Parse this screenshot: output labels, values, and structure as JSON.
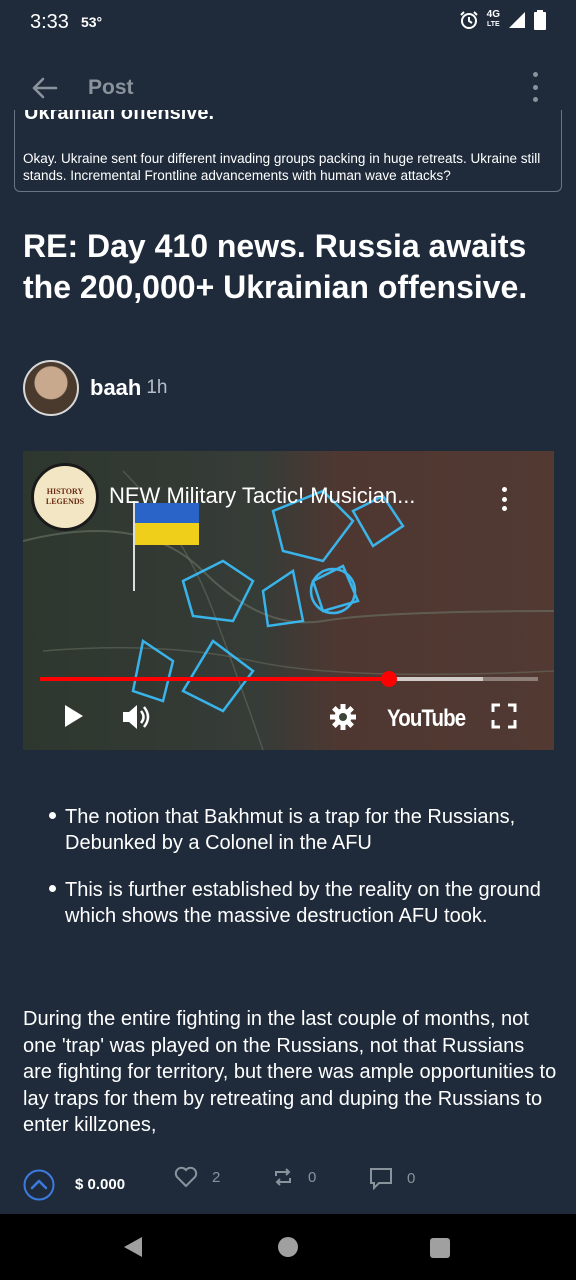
{
  "status": {
    "time": "3:33",
    "temp": "53°",
    "network": "4G",
    "network_sub": "LTE"
  },
  "appbar": {
    "title": "Post"
  },
  "quote": {
    "heading": "Ukrainian offensive.",
    "text": "Okay. Ukraine sent four different invading groups packing in huge retreats. Ukraine still stands. Incremental Frontline advancements with human wave attacks?"
  },
  "post": {
    "title": "RE: Day 410 news. Russia awaits the 200,000+ Ukrainian offensive.",
    "author": "baah",
    "time": "1h"
  },
  "video": {
    "title": "NEW Military Tactic! Musician...",
    "channel_line1": "HISTORY",
    "channel_line2": "LEGENDS",
    "progress": 0.7,
    "buffered": 0.89,
    "brand": "YouTube"
  },
  "bullets": [
    "The notion that Bakhmut is a trap for the Russians, Debunked by a Colonel in the AFU",
    "This is further established by the reality on the ground which shows the massive destruction AFU took."
  ],
  "body": "During the entire fighting in the last couple of months, not one 'trap' was played on the Russians, not that Russians are fighting for territory, but there was ample opportunities to lay traps for them by retreating and duping the Russians to enter killzones, ",
  "actions": {
    "payout": "$ 0.000",
    "likes": "2",
    "reblogs": "0",
    "comments": "0"
  },
  "colors": {
    "background": "#1f2b3b",
    "accent": "#3b7be0",
    "progress": "#ff0000"
  }
}
